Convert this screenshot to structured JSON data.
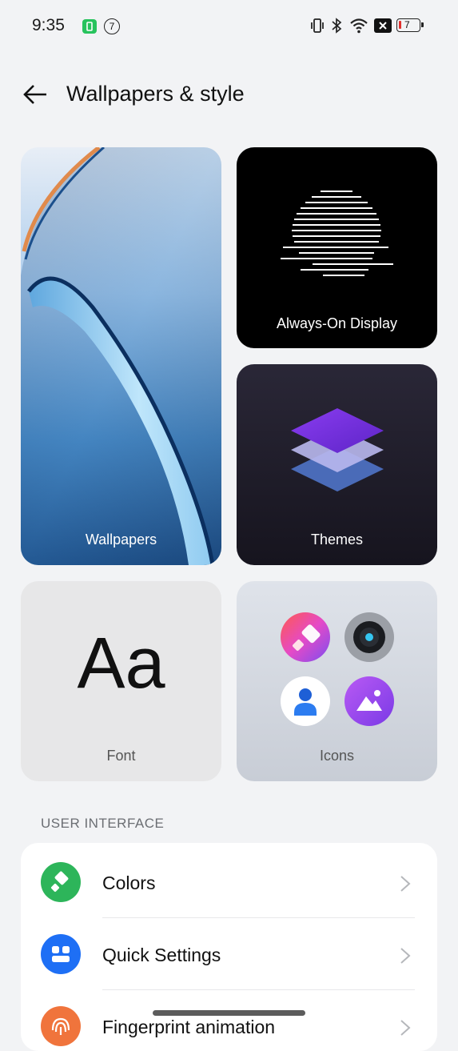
{
  "status": {
    "time": "9:35",
    "notification_badge": "7",
    "battery_level": "7",
    "icons": [
      "battery-saver-icon",
      "notification-count-icon",
      "vibrate-icon",
      "bluetooth-icon",
      "wifi-icon",
      "nfc-icon",
      "battery-icon"
    ]
  },
  "header": {
    "title": "Wallpapers & style",
    "back_icon": "arrow-left-icon"
  },
  "tiles": {
    "wallpapers": "Wallpapers",
    "aod": "Always-On Display",
    "themes": "Themes",
    "font": "Font",
    "font_sample": "Aa",
    "icons": "Icons"
  },
  "section": {
    "user_interface": "USER INTERFACE"
  },
  "rows": [
    {
      "label": "Colors",
      "icon": "paint-bucket-icon",
      "color": "#2db55a"
    },
    {
      "label": "Quick Settings",
      "icon": "toggles-icon",
      "color": "#1e6ff5"
    },
    {
      "label": "Fingerprint animation",
      "icon": "fingerprint-icon",
      "color": "#f0743c"
    }
  ]
}
